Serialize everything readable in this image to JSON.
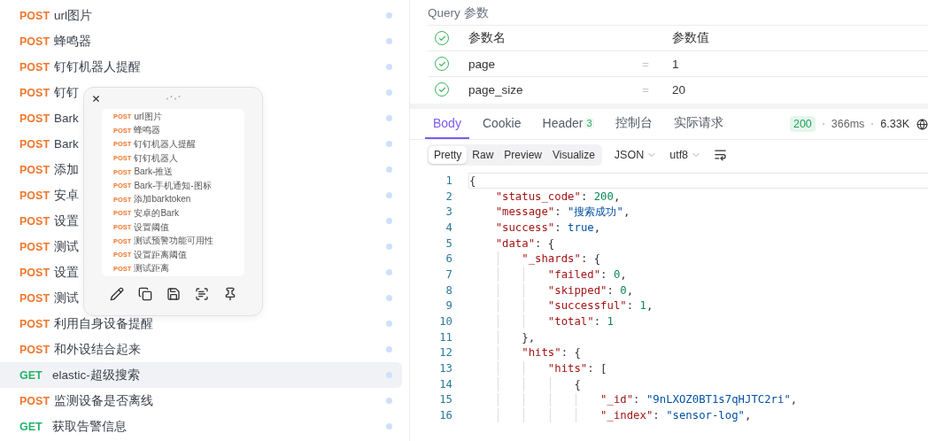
{
  "sidebar": {
    "items": [
      {
        "method": "POST",
        "name": "url图片",
        "selected": false
      },
      {
        "method": "POST",
        "name": "蜂鸣器",
        "selected": false
      },
      {
        "method": "POST",
        "name": "钉钉机器人提醒",
        "selected": false
      },
      {
        "method": "POST",
        "name": "钉钉",
        "selected": false
      },
      {
        "method": "POST",
        "name": "Bark",
        "selected": false
      },
      {
        "method": "POST",
        "name": "Bark",
        "selected": false
      },
      {
        "method": "POST",
        "name": "添加",
        "selected": false
      },
      {
        "method": "POST",
        "name": "安卓",
        "selected": false
      },
      {
        "method": "POST",
        "name": "设置",
        "selected": false
      },
      {
        "method": "POST",
        "name": "测试",
        "selected": false
      },
      {
        "method": "POST",
        "name": "设置",
        "selected": false
      },
      {
        "method": "POST",
        "name": "测试",
        "selected": false
      },
      {
        "method": "POST",
        "name": "利用自身设备提醒",
        "selected": false
      },
      {
        "method": "POST",
        "name": "和外设结合起来",
        "selected": false
      },
      {
        "method": "GET",
        "name": "elastic-超级搜索",
        "selected": true
      },
      {
        "method": "POST",
        "name": "监测设备是否离线",
        "selected": false
      },
      {
        "method": "GET",
        "name": "获取告警信息",
        "selected": false
      }
    ]
  },
  "preview_popup": {
    "items": [
      {
        "method": "POST",
        "name": "url图片"
      },
      {
        "method": "POST",
        "name": "蜂鸣器"
      },
      {
        "method": "POST",
        "name": "钉钉机器人提醒"
      },
      {
        "method": "POST",
        "name": "钉钉机器人"
      },
      {
        "method": "POST",
        "name": "Bark-推送"
      },
      {
        "method": "POST",
        "name": "Bark-手机通知-图标"
      },
      {
        "method": "POST",
        "name": "添加barktoken"
      },
      {
        "method": "POST",
        "name": "安卓的Bark"
      },
      {
        "method": "POST",
        "name": "设置阈值"
      },
      {
        "method": "POST",
        "name": "测试预警功能可用性"
      },
      {
        "method": "POST",
        "name": "设置距离阈值"
      },
      {
        "method": "POST",
        "name": "测试距离"
      }
    ]
  },
  "query_params": {
    "title": "Query 参数",
    "header": {
      "checked": true,
      "name": "参数名",
      "value": "参数值"
    },
    "rows": [
      {
        "checked": true,
        "name": "page",
        "equals": "=",
        "value": "1"
      },
      {
        "checked": true,
        "name": "page_size",
        "equals": "=",
        "value": "20"
      }
    ]
  },
  "response": {
    "tabs": [
      {
        "label": "Body",
        "selected": true
      },
      {
        "label": "Cookie",
        "selected": false
      },
      {
        "label": "Header",
        "badge": "3",
        "selected": false
      },
      {
        "label": "控制台",
        "selected": false
      },
      {
        "label": "实际请求",
        "selected": false
      }
    ],
    "status": "200",
    "time": "366ms",
    "size": "6.33K",
    "views": [
      {
        "label": "Pretty",
        "selected": true
      },
      {
        "label": "Raw",
        "selected": false
      },
      {
        "label": "Preview",
        "selected": false
      },
      {
        "label": "Visualize",
        "selected": false
      }
    ],
    "format": "JSON",
    "encoding": "utf8",
    "code_lines": [
      {
        "num": "1",
        "text": "{"
      },
      {
        "num": "2",
        "text": "    \"status_code\": 200,"
      },
      {
        "num": "3",
        "text": "    \"message\": \"搜索成功\","
      },
      {
        "num": "4",
        "text": "    \"success\": true,"
      },
      {
        "num": "5",
        "text": "    \"data\": {"
      },
      {
        "num": "6",
        "text": "        \"_shards\": {"
      },
      {
        "num": "7",
        "text": "            \"failed\": 0,"
      },
      {
        "num": "8",
        "text": "            \"skipped\": 0,"
      },
      {
        "num": "9",
        "text": "            \"successful\": 1,"
      },
      {
        "num": "10",
        "text": "            \"total\": 1"
      },
      {
        "num": "11",
        "text": "        },"
      },
      {
        "num": "12",
        "text": "        \"hits\": {"
      },
      {
        "num": "13",
        "text": "            \"hits\": ["
      },
      {
        "num": "14",
        "text": "                {"
      },
      {
        "num": "15",
        "text": "                    \"_id\": \"9nLXOZ0BT1s7qHJTC2ri\","
      },
      {
        "num": "16",
        "text": "                    \"_index\": \"sensor-log\","
      }
    ]
  }
}
